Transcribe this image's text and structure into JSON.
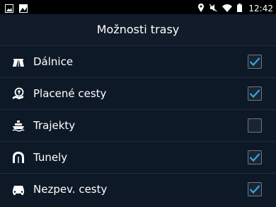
{
  "status_bar": {
    "time": "12:42",
    "left_icons": [
      "image-icon",
      "photo-icon"
    ],
    "right_icons": [
      "location-icon",
      "mute-icon",
      "wifi-icon",
      "battery-icon"
    ]
  },
  "header": {
    "title": "Možnosti trasy"
  },
  "options": [
    {
      "label": "Dálnice",
      "icon": "highway-icon",
      "checked": true
    },
    {
      "label": "Placené cesty",
      "icon": "toll-road-icon",
      "checked": true
    },
    {
      "label": "Trajekty",
      "icon": "ferry-icon",
      "checked": false
    },
    {
      "label": "Tunely",
      "icon": "tunnel-icon",
      "checked": true
    },
    {
      "label": "Nezpev. cesty",
      "icon": "unpaved-road-icon",
      "checked": true
    }
  ],
  "colors": {
    "background": "#0e1928",
    "header_background": "#111b29",
    "divider": "#1f2c3c",
    "checkmark": "#35a8e0"
  }
}
